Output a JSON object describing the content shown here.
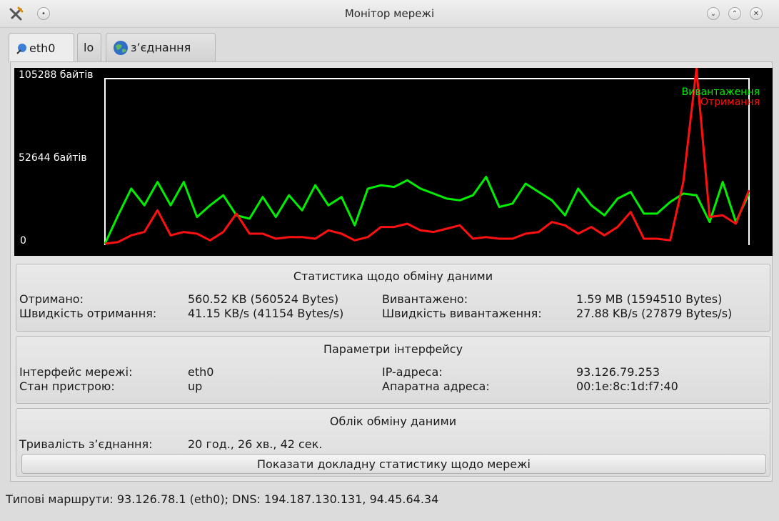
{
  "window": {
    "title": "Монітор мережі"
  },
  "tabs": [
    {
      "label": "eth0",
      "icon": "network-icon"
    },
    {
      "label": "lo",
      "icon": ""
    },
    {
      "label": "з’єднання",
      "icon": "globe-icon"
    }
  ],
  "graph": {
    "y_max_label": "105288 байтів",
    "y_mid_label": "52644 байтів",
    "y_min_label": "0",
    "legend_upload": "Вивантаження",
    "legend_download": "Отримання",
    "colors": {
      "upload": "#00ee00",
      "download": "#ff1010"
    }
  },
  "chart_data": {
    "type": "line",
    "ylim": [
      0,
      105288
    ],
    "series": [
      {
        "name": "Вивантаження",
        "values": [
          0,
          17000,
          33000,
          23000,
          37000,
          23000,
          37000,
          16000,
          23000,
          29000,
          17000,
          15000,
          28000,
          16000,
          29000,
          20000,
          35000,
          23000,
          28000,
          11000,
          33000,
          35000,
          34000,
          38000,
          33000,
          30000,
          27000,
          26000,
          29000,
          40000,
          22000,
          24000,
          36000,
          31000,
          26000,
          17000,
          33000,
          23000,
          17000,
          27000,
          31000,
          18000,
          18000,
          25000,
          30000,
          29000,
          13000,
          37000,
          13000,
          30000
        ]
      },
      {
        "name": "Отримання",
        "values": [
          0,
          1000,
          5000,
          7000,
          20000,
          5000,
          7000,
          6000,
          2000,
          7000,
          18000,
          6000,
          6000,
          3000,
          4000,
          4000,
          3000,
          8000,
          6000,
          2000,
          4000,
          10000,
          10000,
          12000,
          8000,
          7000,
          9000,
          11000,
          3000,
          4000,
          3000,
          3000,
          6000,
          7000,
          13000,
          11000,
          6000,
          10000,
          5000,
          10000,
          19000,
          3000,
          3000,
          2000,
          37000,
          105000,
          16000,
          17000,
          12000,
          32000
        ]
      }
    ]
  },
  "stats": {
    "title": "Статистика щодо обміну даними",
    "received_label": "Отримано:",
    "received_value": "560.52 KB (560524 Bytes)",
    "uploaded_label": "Вивантажено:",
    "uploaded_value": "1.59 MB (1594510 Bytes)",
    "rx_speed_label": "Швидкість отримання:",
    "rx_speed_value": "41.15 KB/s (41154 Bytes/s)",
    "tx_speed_label": "Швидкість вивантаження:",
    "tx_speed_value": "27.88 KB/s (27879 Bytes/s)"
  },
  "iface": {
    "title": "Параметри інтерфейсу",
    "name_label": "Інтерфейс мережі:",
    "name_value": "eth0",
    "state_label": "Стан пристрою:",
    "state_value": "up",
    "ip_label": "IP-адреса:",
    "ip_value": "93.126.79.253",
    "hw_label": "Апаратна адреса:",
    "hw_value": "00:1e:8c:1d:f7:40"
  },
  "accounting": {
    "title": "Облік обміну даними",
    "duration_label": "Тривалість з’єднання:",
    "duration_value": "20 год., 26 хв., 42 сек.",
    "details_button": "Показати докладну статистику щодо мережі"
  },
  "status_bar": "Типові маршрути: 93.126.78.1 (eth0); DNS: 194.187.130.131, 94.45.64.34"
}
